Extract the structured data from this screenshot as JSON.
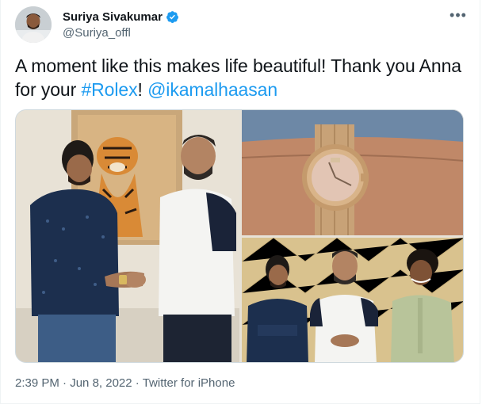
{
  "author": {
    "display_name": "Suriya Sivakumar",
    "handle": "@Suriya_offl",
    "verified": true,
    "avatar_icon": "profile-photo"
  },
  "more_icon": "ellipsis-icon",
  "tweet": {
    "text_prefix": "A moment like this makes life beautiful! Thank you Anna for your ",
    "hashtag": "#Rolex",
    "text_middle": "! ",
    "mention": "@ikamalhaasan"
  },
  "media": {
    "count": 3,
    "photos": [
      "two-men-handshake-with-tiger-painting",
      "gold-wristwatch-on-wrist",
      "three-men-posing"
    ]
  },
  "meta": {
    "time": "2:39 PM",
    "separator": " · ",
    "date": "Jun 8, 2022",
    "source": "Twitter for iPhone"
  },
  "colors": {
    "link": "#1d9bf0",
    "text": "#0f1419",
    "secondary": "#536471",
    "verified": "#1d9bf0"
  }
}
